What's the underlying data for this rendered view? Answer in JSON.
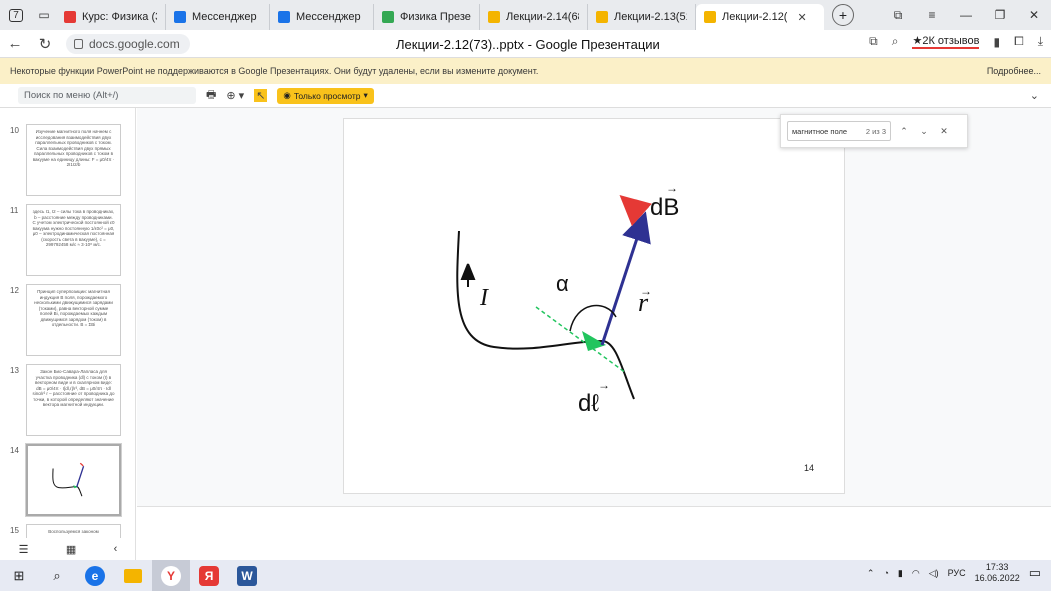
{
  "browser": {
    "tabs": [
      {
        "label": "Курс: Физика (3",
        "color": "#e53935",
        "active": false
      },
      {
        "label": "Мессенджер",
        "color": "#1a73e8",
        "active": false
      },
      {
        "label": "Мессенджер",
        "color": "#1a73e8",
        "active": false
      },
      {
        "label": "Физика Презент",
        "color": "#34a853",
        "active": false
      },
      {
        "label": "Лекции-2.14(68",
        "color": "#f4b400",
        "active": false
      },
      {
        "label": "Лекции-2.13(51",
        "color": "#f4b400",
        "active": false
      },
      {
        "label": "Лекции-2.12(",
        "color": "#f4b400",
        "active": true
      }
    ],
    "tab_counter": "7",
    "url": "docs.google.com",
    "page_title": "Лекции-2.12(73)..pptx - Google Презентации",
    "reviews": "★2К отзывов"
  },
  "warning": {
    "text": "Некоторые функции PowerPoint не поддерживаются в Google Презентациях. Они будут удалены, если вы измените документ.",
    "more": "Подробнее..."
  },
  "toolbar": {
    "menu_search_placeholder": "Поиск по меню (Alt+/)",
    "view_only": "Только просмотр"
  },
  "find": {
    "query": "магнитное поле",
    "count": "2 из 3"
  },
  "filmstrip": [
    {
      "num": "10",
      "text": "Изучение магнитного поля начнем с исследования взаимодействия двух параллельных проводников с током. Сила взаимодействия двух прямых параллельных проводников с током в вакууме на единицу длины: F = μ0/4π · 2I1I2/b"
    },
    {
      "num": "11",
      "text": "здесь I1, I2 – силы тока в проводниках, b – расстояние между проводниками. С учетом электрической постоянной ε0 вакуума нужно постоянную 1/ε0c² = μ0, μ0 – электродинамическая постоянная (скорость света в вакууме), c = 299792458 м/с ≈ 3·10⁸ м/с."
    },
    {
      "num": "12",
      "text": "Принцип суперпозиции: магнитная индукция B поля, порождаемого несколькими движущимися зарядами (токами), равна векторной сумме полей Bi, порождаемых каждым движущимся зарядом (током) в отдельности. B = ΣBi"
    },
    {
      "num": "13",
      "text": "Закон Био-Савара-Лапласа для участка проводника (dl) с током (I) в векторном виде и в скалярном виде: dB = μ0/4π · I[dl,r]/r³, dB = μ0/4π · Idl sinα/r² r – расстояние от проводника до точки, в которой определяют значение вектора магнитной индукции."
    },
    {
      "num": "14",
      "text": ""
    },
    {
      "num": "15",
      "text": "Воспользуемся законом"
    }
  ],
  "slide": {
    "labels": {
      "dB": "dB",
      "I": "I",
      "alpha": "α",
      "r": "r",
      "dl": "dℓ"
    },
    "number": "14"
  },
  "taskbar": {
    "lang": "РУС",
    "time": "17:33",
    "date": "16.06.2022"
  },
  "colors": {
    "tab_bar": "#e9ebee",
    "warning_bg": "#fbf0c8",
    "view_only_btn": "#f9c21b",
    "vector_dB": "#e53935",
    "vector_r": "#2e3192",
    "vector_dl": "#22c55e",
    "taskbar": "#e7eaf3"
  }
}
